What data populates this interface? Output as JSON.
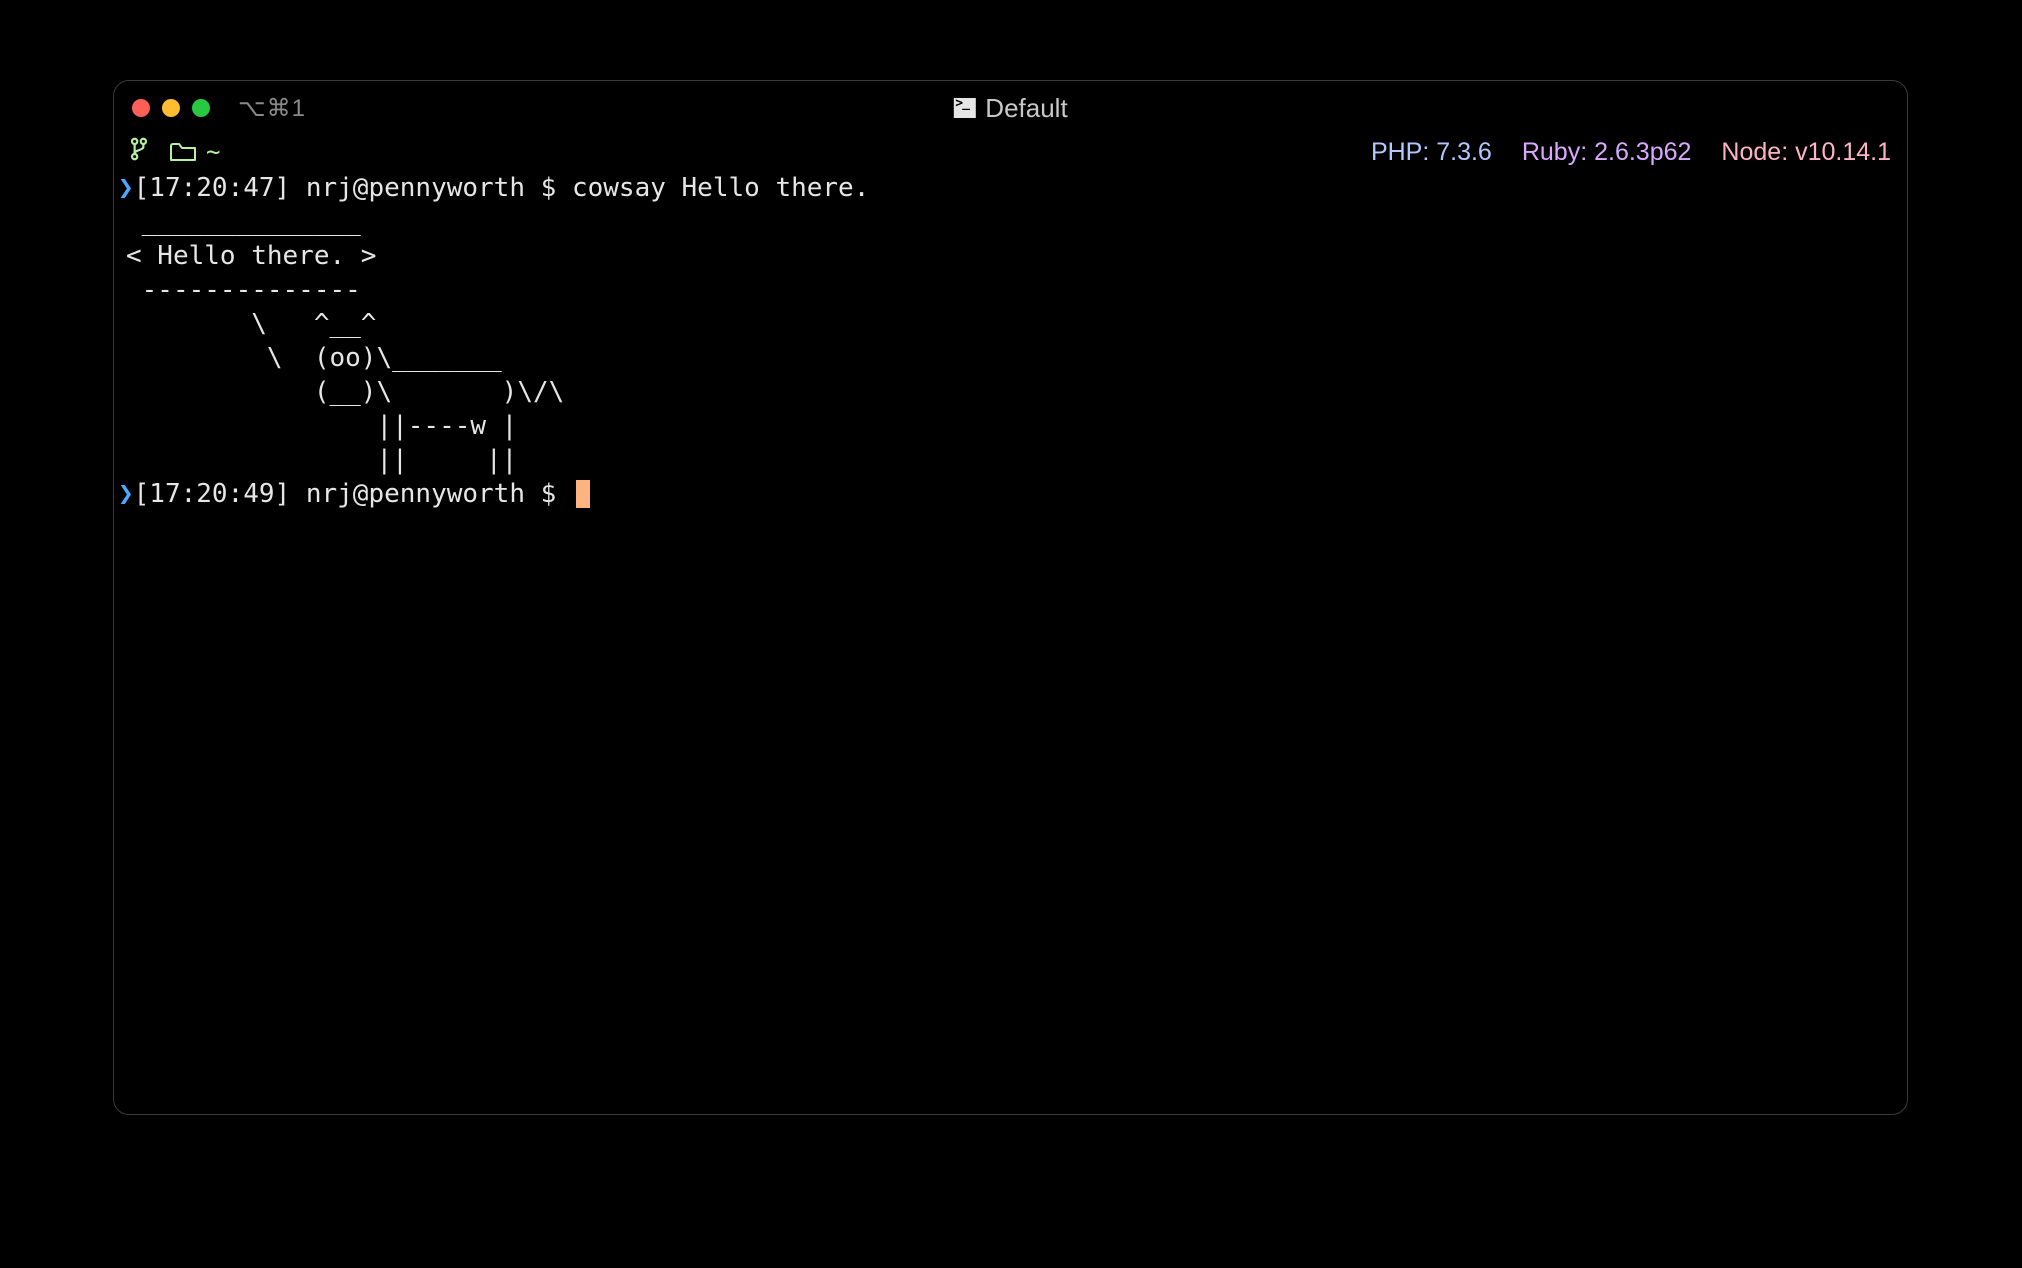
{
  "window": {
    "title": "Default",
    "tab_shortcut": "⌥⌘1"
  },
  "status": {
    "cwd_indicator": "~",
    "php": "PHP: 7.3.6",
    "ruby": "Ruby: 2.6.3p62",
    "node": "Node: v10.14.1"
  },
  "lines": {
    "prompt1_prefix": "[17:20:47] nrj@pennyworth $ ",
    "prompt1_cmd": "cowsay Hello there.",
    "output": " ______________\n< Hello there. >\n --------------\n        \\   ^__^\n         \\  (oo)\\_______\n            (__)\\       )\\/\\\n                ||----w |\n                ||     ||",
    "prompt2_prefix": "[17:20:49] nrj@pennyworth $ "
  }
}
